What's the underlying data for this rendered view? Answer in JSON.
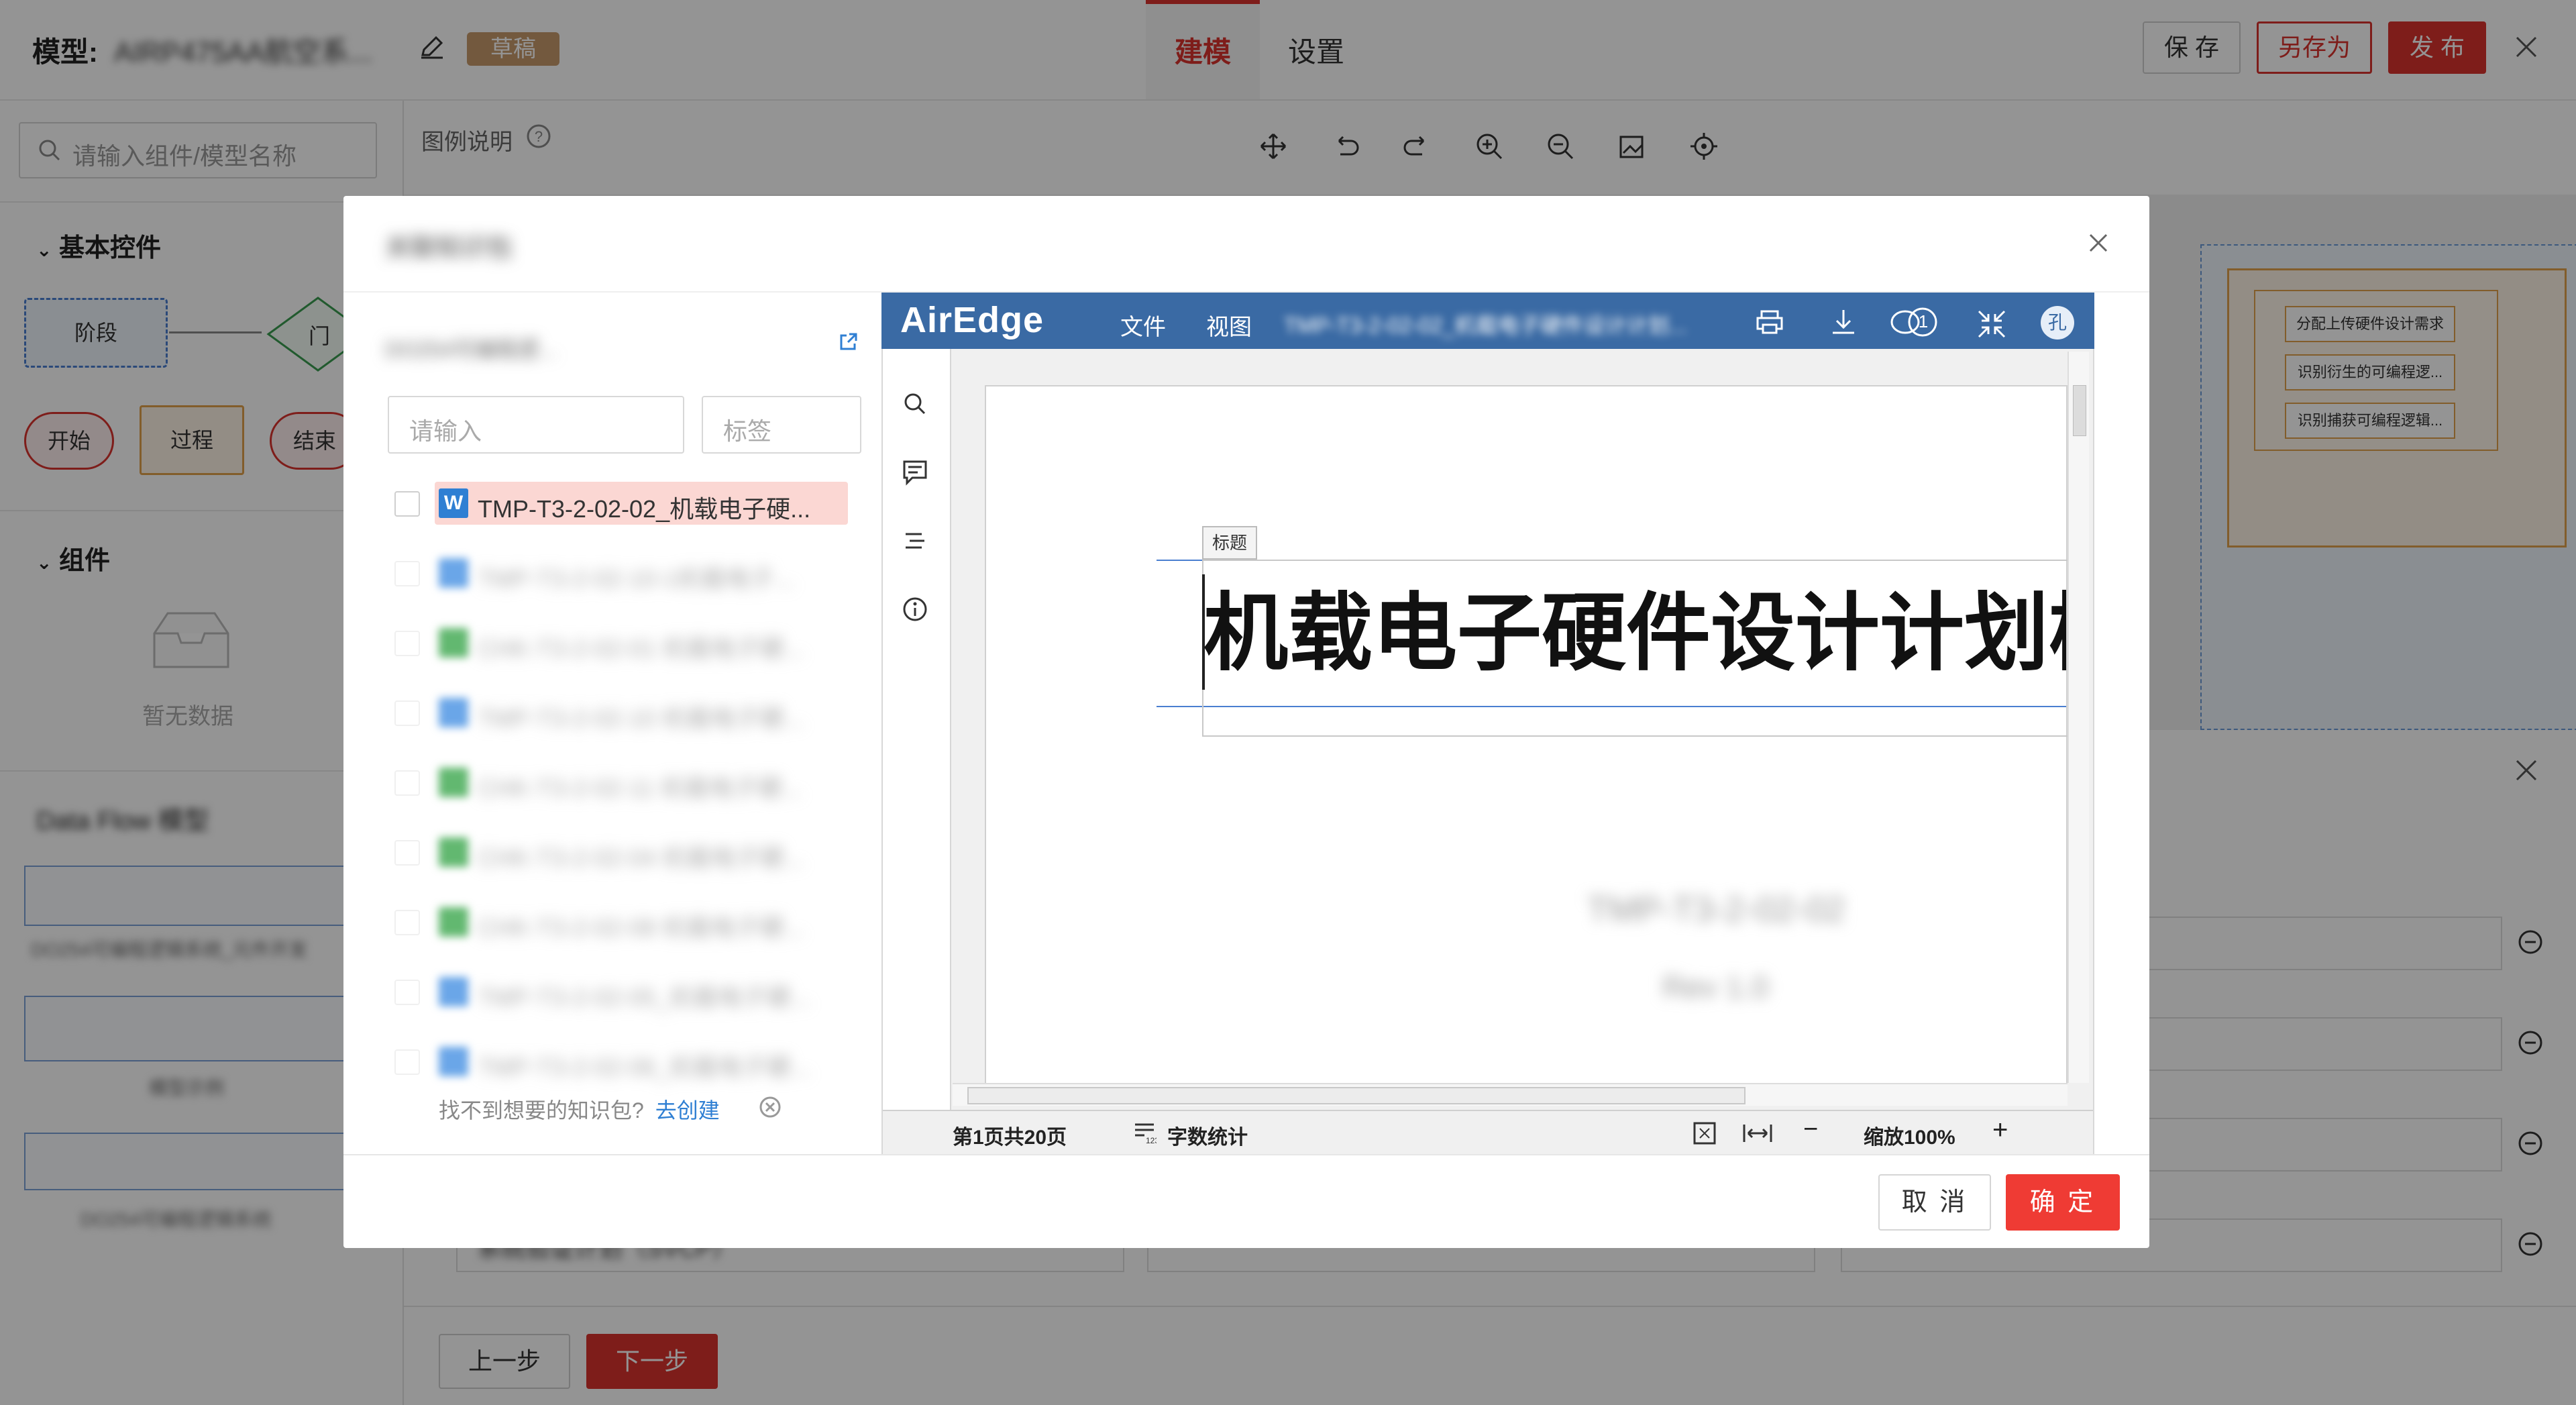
{
  "topbar": {
    "title_prefix": "模型:",
    "model_name": "AIRP475AA航空系...",
    "draft_badge": "草稿",
    "tabs": [
      {
        "label": "建模"
      },
      {
        "label": "设置"
      }
    ],
    "buttons": {
      "save": "保 存",
      "save_as": "另存为",
      "publish": "发 布"
    }
  },
  "left_panel": {
    "search_placeholder": "请输入组件/模型名称",
    "sections": {
      "basic": "基本控件",
      "components": "组件",
      "dataflow": "Data Flow 模型"
    },
    "basic_nodes": {
      "stage": "阶段",
      "gate": "门",
      "start": "开始",
      "process": "过程",
      "end": "结束"
    },
    "empty_text": "暂无数据",
    "dataflow_captions": [
      "DO254可编程逻辑系统_元件开发",
      "模型示例",
      "DO254可编程逻辑系统"
    ]
  },
  "canvas": {
    "legend_label": "图例说明",
    "right_nodes": [
      "分配上传硬件设计需求",
      "识别衍生的可编程逻...",
      "识别捕获可编程逻辑..."
    ],
    "bottom_field": "系统验证计划（SVCP）"
  },
  "footer_buttons": {
    "prev": "上一步",
    "next": "下一步"
  },
  "modal": {
    "title": "关联知识包",
    "kb_select": "DO254可编程逻...",
    "search_placeholder": "请输入",
    "tag_placeholder": "标签",
    "files": [
      {
        "type": "W",
        "name": "TMP-T3-2-02-02_机载电子硬..."
      },
      {
        "type": "W",
        "name": "TMP-T3-2-02-10-1机载电子..."
      },
      {
        "type": "X",
        "name": "CHK-T3-2-02-01 机载电子硬..."
      },
      {
        "type": "W",
        "name": "TMP-T3-2-02-10 机载电子硬..."
      },
      {
        "type": "X",
        "name": "CHK-T3-2-02-11 机载电子硬..."
      },
      {
        "type": "X",
        "name": "CHK-T3-2-02-04 机载电子硬..."
      },
      {
        "type": "X",
        "name": "CHK-T3-2-02-08 机载电子硬..."
      },
      {
        "type": "W",
        "name": "TMP-T3-2-02-05_机载电子硬..."
      },
      {
        "type": "W",
        "name": "TMP-T3-2-02-06_机载电子硬..."
      }
    ],
    "not_found_text": "找不到想要的知识包?",
    "create_link": "去创建",
    "buttons": {
      "cancel": "取 消",
      "ok": "确 定"
    }
  },
  "viewer": {
    "brand": "AirEdge",
    "menu": [
      "文件",
      "视图"
    ],
    "doc_title": "TMP-T3-2-02-02_机载电子硬件设计计划...",
    "comment_count": "1",
    "avatar_letter": "孔",
    "title_tag": "标题",
    "doc_heading": "机载电子硬件设计计划模",
    "doc_code": "TMP-T3-2-02-02",
    "doc_rev": "Rev 1.0",
    "status": {
      "page": "第1页共20页",
      "word_count": "字数统计",
      "zoom": "缩放100%"
    }
  },
  "colors": {
    "accent": "#d9322d",
    "viewer_bar": "#3a6aa4",
    "link": "#2f7fd3"
  }
}
